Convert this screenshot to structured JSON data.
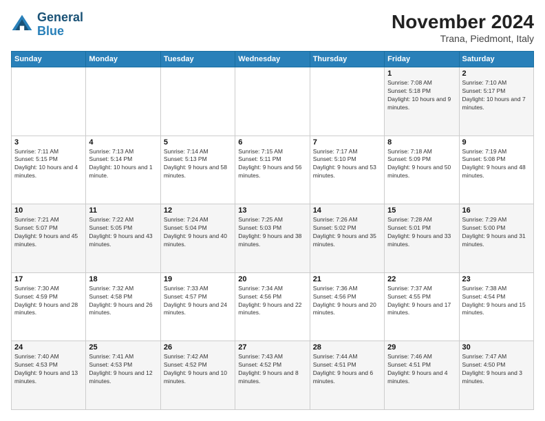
{
  "header": {
    "logo_line1": "General",
    "logo_line2": "Blue",
    "month_title": "November 2024",
    "subtitle": "Trana, Piedmont, Italy"
  },
  "weekdays": [
    "Sunday",
    "Monday",
    "Tuesday",
    "Wednesday",
    "Thursday",
    "Friday",
    "Saturday"
  ],
  "weeks": [
    [
      {
        "day": "",
        "info": ""
      },
      {
        "day": "",
        "info": ""
      },
      {
        "day": "",
        "info": ""
      },
      {
        "day": "",
        "info": ""
      },
      {
        "day": "",
        "info": ""
      },
      {
        "day": "1",
        "info": "Sunrise: 7:08 AM\nSunset: 5:18 PM\nDaylight: 10 hours and 9 minutes."
      },
      {
        "day": "2",
        "info": "Sunrise: 7:10 AM\nSunset: 5:17 PM\nDaylight: 10 hours and 7 minutes."
      }
    ],
    [
      {
        "day": "3",
        "info": "Sunrise: 7:11 AM\nSunset: 5:15 PM\nDaylight: 10 hours and 4 minutes."
      },
      {
        "day": "4",
        "info": "Sunrise: 7:13 AM\nSunset: 5:14 PM\nDaylight: 10 hours and 1 minute."
      },
      {
        "day": "5",
        "info": "Sunrise: 7:14 AM\nSunset: 5:13 PM\nDaylight: 9 hours and 58 minutes."
      },
      {
        "day": "6",
        "info": "Sunrise: 7:15 AM\nSunset: 5:11 PM\nDaylight: 9 hours and 56 minutes."
      },
      {
        "day": "7",
        "info": "Sunrise: 7:17 AM\nSunset: 5:10 PM\nDaylight: 9 hours and 53 minutes."
      },
      {
        "day": "8",
        "info": "Sunrise: 7:18 AM\nSunset: 5:09 PM\nDaylight: 9 hours and 50 minutes."
      },
      {
        "day": "9",
        "info": "Sunrise: 7:19 AM\nSunset: 5:08 PM\nDaylight: 9 hours and 48 minutes."
      }
    ],
    [
      {
        "day": "10",
        "info": "Sunrise: 7:21 AM\nSunset: 5:07 PM\nDaylight: 9 hours and 45 minutes."
      },
      {
        "day": "11",
        "info": "Sunrise: 7:22 AM\nSunset: 5:05 PM\nDaylight: 9 hours and 43 minutes."
      },
      {
        "day": "12",
        "info": "Sunrise: 7:24 AM\nSunset: 5:04 PM\nDaylight: 9 hours and 40 minutes."
      },
      {
        "day": "13",
        "info": "Sunrise: 7:25 AM\nSunset: 5:03 PM\nDaylight: 9 hours and 38 minutes."
      },
      {
        "day": "14",
        "info": "Sunrise: 7:26 AM\nSunset: 5:02 PM\nDaylight: 9 hours and 35 minutes."
      },
      {
        "day": "15",
        "info": "Sunrise: 7:28 AM\nSunset: 5:01 PM\nDaylight: 9 hours and 33 minutes."
      },
      {
        "day": "16",
        "info": "Sunrise: 7:29 AM\nSunset: 5:00 PM\nDaylight: 9 hours and 31 minutes."
      }
    ],
    [
      {
        "day": "17",
        "info": "Sunrise: 7:30 AM\nSunset: 4:59 PM\nDaylight: 9 hours and 28 minutes."
      },
      {
        "day": "18",
        "info": "Sunrise: 7:32 AM\nSunset: 4:58 PM\nDaylight: 9 hours and 26 minutes."
      },
      {
        "day": "19",
        "info": "Sunrise: 7:33 AM\nSunset: 4:57 PM\nDaylight: 9 hours and 24 minutes."
      },
      {
        "day": "20",
        "info": "Sunrise: 7:34 AM\nSunset: 4:56 PM\nDaylight: 9 hours and 22 minutes."
      },
      {
        "day": "21",
        "info": "Sunrise: 7:36 AM\nSunset: 4:56 PM\nDaylight: 9 hours and 20 minutes."
      },
      {
        "day": "22",
        "info": "Sunrise: 7:37 AM\nSunset: 4:55 PM\nDaylight: 9 hours and 17 minutes."
      },
      {
        "day": "23",
        "info": "Sunrise: 7:38 AM\nSunset: 4:54 PM\nDaylight: 9 hours and 15 minutes."
      }
    ],
    [
      {
        "day": "24",
        "info": "Sunrise: 7:40 AM\nSunset: 4:53 PM\nDaylight: 9 hours and 13 minutes."
      },
      {
        "day": "25",
        "info": "Sunrise: 7:41 AM\nSunset: 4:53 PM\nDaylight: 9 hours and 12 minutes."
      },
      {
        "day": "26",
        "info": "Sunrise: 7:42 AM\nSunset: 4:52 PM\nDaylight: 9 hours and 10 minutes."
      },
      {
        "day": "27",
        "info": "Sunrise: 7:43 AM\nSunset: 4:52 PM\nDaylight: 9 hours and 8 minutes."
      },
      {
        "day": "28",
        "info": "Sunrise: 7:44 AM\nSunset: 4:51 PM\nDaylight: 9 hours and 6 minutes."
      },
      {
        "day": "29",
        "info": "Sunrise: 7:46 AM\nSunset: 4:51 PM\nDaylight: 9 hours and 4 minutes."
      },
      {
        "day": "30",
        "info": "Sunrise: 7:47 AM\nSunset: 4:50 PM\nDaylight: 9 hours and 3 minutes."
      }
    ]
  ]
}
